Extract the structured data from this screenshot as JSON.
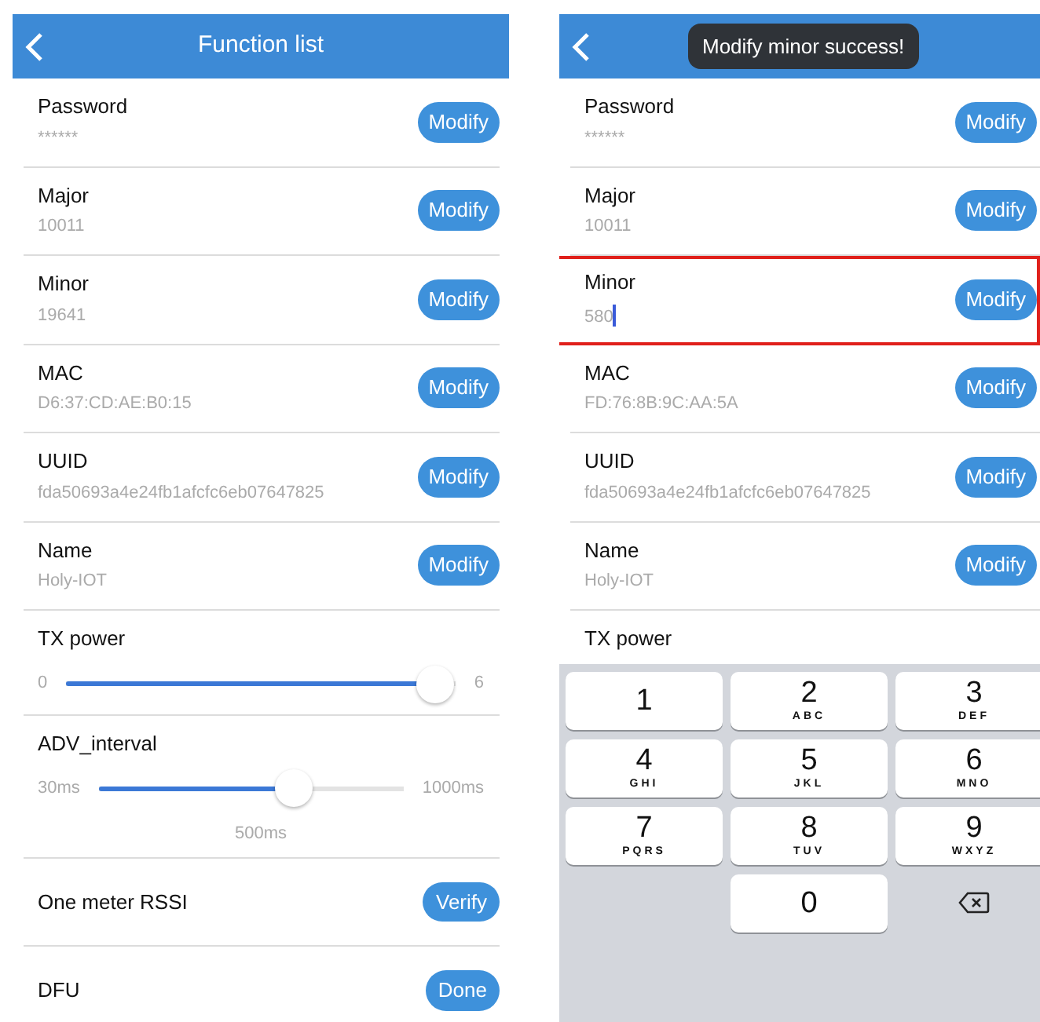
{
  "screens": [
    {
      "title": "Function list",
      "rows": [
        {
          "kind": "field",
          "label": "Password",
          "value": "******",
          "button": "Modify",
          "highlighted": false,
          "editing": false
        },
        {
          "kind": "field",
          "label": "Major",
          "value": "10011",
          "button": "Modify",
          "highlighted": false,
          "editing": false
        },
        {
          "kind": "field",
          "label": "Minor",
          "value": "19641",
          "button": "Modify",
          "highlighted": false,
          "editing": false
        },
        {
          "kind": "field",
          "label": "MAC",
          "value": "D6:37:CD:AE:B0:15",
          "button": "Modify",
          "highlighted": false,
          "editing": false
        },
        {
          "kind": "field",
          "label": "UUID",
          "value": "fda50693a4e24fb1afcfc6eb07647825",
          "button": "Modify",
          "highlighted": false,
          "editing": false
        },
        {
          "kind": "field",
          "label": "Name",
          "value": "Holy-IOT",
          "button": "Modify",
          "highlighted": false,
          "editing": false
        },
        {
          "kind": "slider",
          "label": "TX power",
          "min": "0",
          "max": "6",
          "level": 0.95
        },
        {
          "kind": "slider",
          "label": "ADV_interval",
          "min": "30ms",
          "max": "1000ms",
          "level": 0.64,
          "reading": "500ms"
        },
        {
          "kind": "action",
          "label": "One meter RSSI",
          "button": "Verify"
        },
        {
          "kind": "action",
          "label": "DFU",
          "button": "Done"
        }
      ]
    },
    {
      "toast": "Modify minor success!",
      "rows": [
        {
          "kind": "field",
          "label": "Password",
          "value": "******",
          "button": "Modify",
          "highlighted": false,
          "editing": false
        },
        {
          "kind": "field",
          "label": "Major",
          "value": "10011",
          "button": "Modify",
          "highlighted": false,
          "editing": false
        },
        {
          "kind": "field",
          "label": "Minor",
          "value": "580",
          "button": "Modify",
          "highlighted": true,
          "editing": true
        },
        {
          "kind": "field",
          "label": "MAC",
          "value": "FD:76:8B:9C:AA:5A",
          "button": "Modify",
          "highlighted": false,
          "editing": false
        },
        {
          "kind": "field",
          "label": "UUID",
          "value": "fda50693a4e24fb1afcfc6eb07647825",
          "button": "Modify",
          "highlighted": false,
          "editing": false
        },
        {
          "kind": "field",
          "label": "Name",
          "value": "Holy-IOT",
          "button": "Modify",
          "highlighted": false,
          "editing": false
        },
        {
          "kind": "heading",
          "label": "TX power"
        }
      ],
      "keyboard": [
        {
          "kind": "digit",
          "digit": "1"
        },
        {
          "kind": "digit",
          "digit": "2",
          "letters": "ABC"
        },
        {
          "kind": "digit",
          "digit": "3",
          "letters": "DEF"
        },
        {
          "kind": "digit",
          "digit": "4",
          "letters": "GHI"
        },
        {
          "kind": "digit",
          "digit": "5",
          "letters": "JKL"
        },
        {
          "kind": "digit",
          "digit": "6",
          "letters": "MNO"
        },
        {
          "kind": "digit",
          "digit": "7",
          "letters": "PQRS"
        },
        {
          "kind": "digit",
          "digit": "8",
          "letters": "TUV"
        },
        {
          "kind": "digit",
          "digit": "9",
          "letters": "WXYZ"
        },
        {
          "kind": "blank"
        },
        {
          "kind": "digit",
          "digit": "0"
        },
        {
          "kind": "backspace"
        }
      ]
    }
  ]
}
